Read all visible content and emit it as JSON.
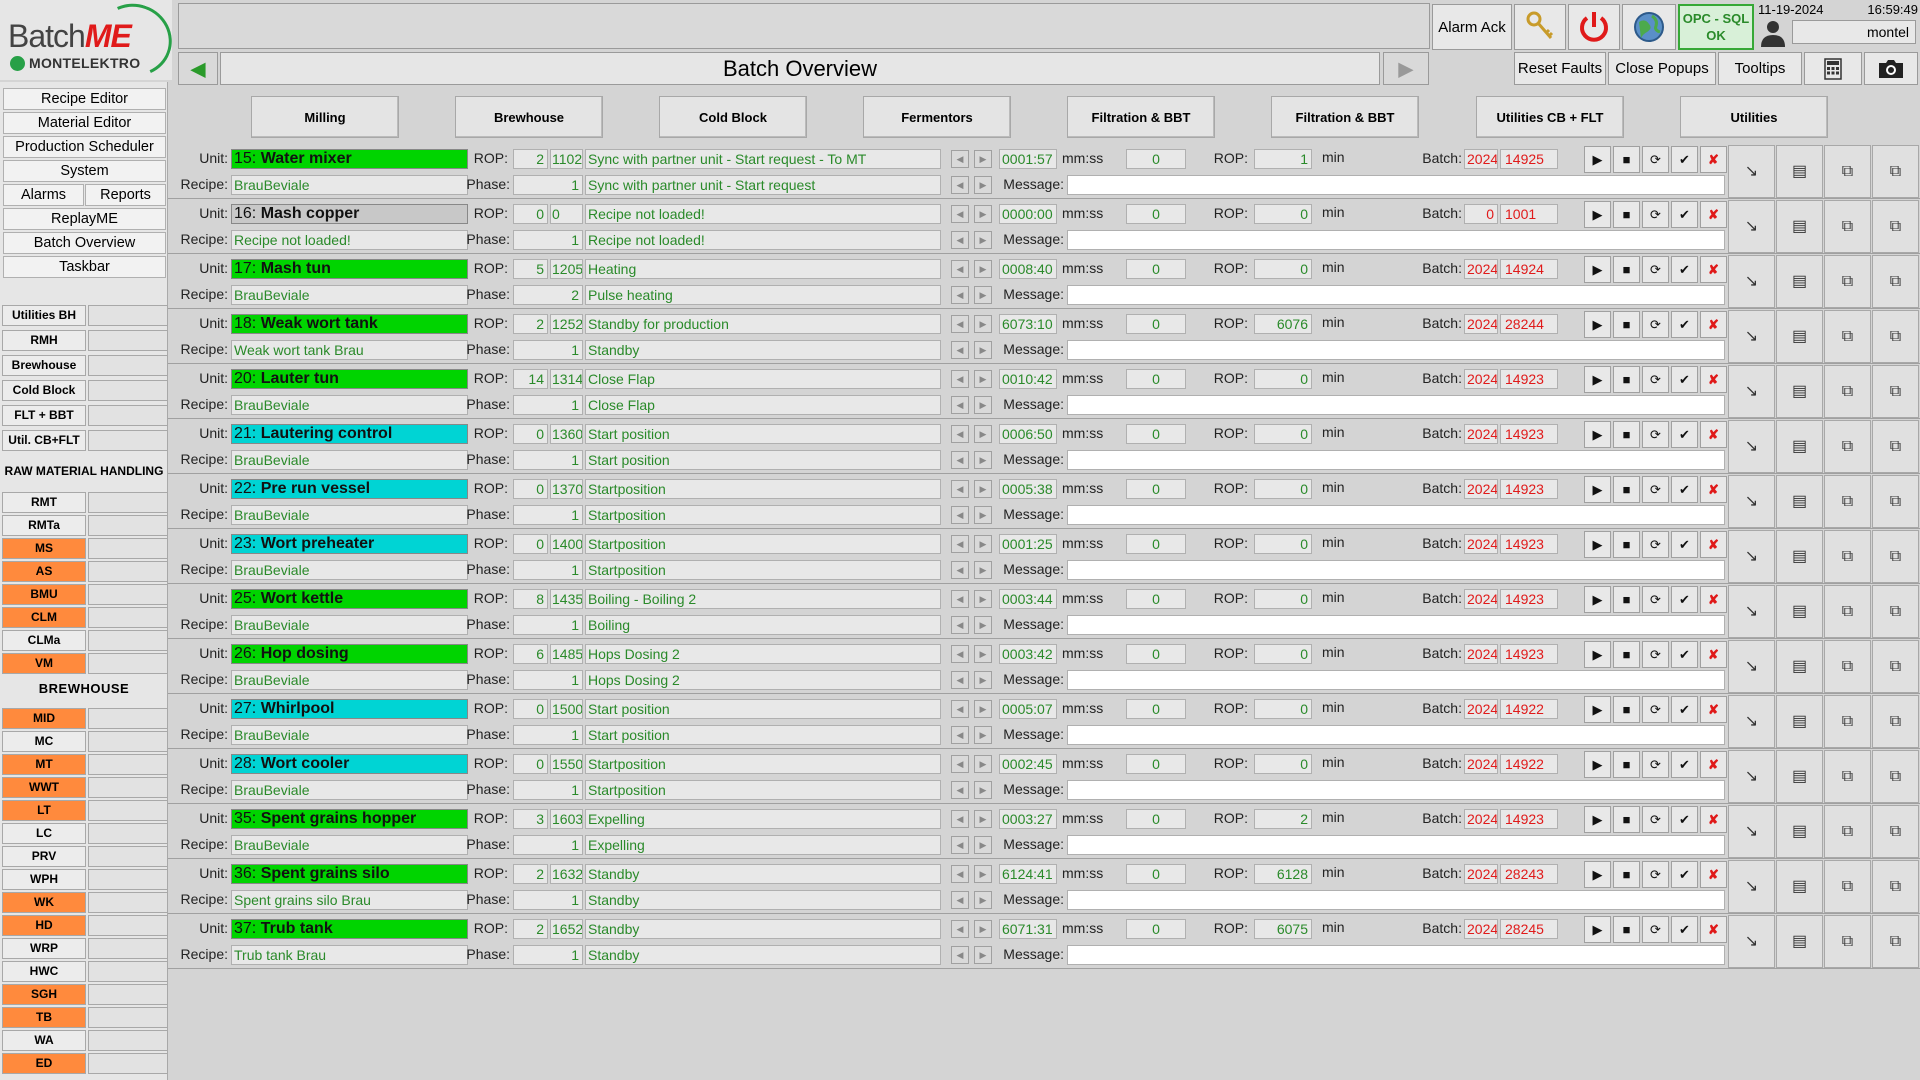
{
  "brand": {
    "name_part1": "Batch",
    "name_part2": "ME",
    "company": "MONTELEKTRO"
  },
  "header": {
    "page_title": "Batch Overview",
    "alarm_ack": "Alarm Ack",
    "reset_faults": "Reset Faults",
    "close_popups": "Close Popups",
    "tooltips": "Tooltips",
    "opc_status_line1": "OPC - SQL",
    "opc_status_line2": "OK",
    "date": "11-19-2024",
    "time": "16:59:49",
    "user": "montel",
    "icons": [
      "keys-icon",
      "power-icon",
      "globe-icon",
      "calculator-icon",
      "camera-icon"
    ]
  },
  "sidebar": {
    "menu": [
      "Recipe Editor",
      "Material Editor",
      "Production Scheduler",
      "System",
      "Alarms",
      "Reports",
      "ReplayME",
      "Batch Overview",
      "Taskbar"
    ],
    "area_buttons": [
      "Utilities BH",
      "RMH",
      "Brewhouse",
      "Cold Block",
      "FLT + BBT",
      "Util. CB+FLT"
    ],
    "raw_material_header": "RAW MATERIAL HANDLING",
    "raw_material_items": [
      {
        "label": "RMT",
        "orange": false
      },
      {
        "label": "RMTa",
        "orange": false
      },
      {
        "label": "MS",
        "orange": true
      },
      {
        "label": "AS",
        "orange": true
      },
      {
        "label": "BMU",
        "orange": true
      },
      {
        "label": "CLM",
        "orange": true
      },
      {
        "label": "CLMa",
        "orange": false
      },
      {
        "label": "VM",
        "orange": true
      }
    ],
    "brewhouse_header": "BREWHOUSE",
    "brewhouse_items": [
      {
        "label": "MID",
        "orange": true
      },
      {
        "label": "MC",
        "orange": false
      },
      {
        "label": "MT",
        "orange": true
      },
      {
        "label": "WWT",
        "orange": true
      },
      {
        "label": "LT",
        "orange": true
      },
      {
        "label": "LC",
        "orange": false
      },
      {
        "label": "PRV",
        "orange": false
      },
      {
        "label": "WPH",
        "orange": false
      },
      {
        "label": "WK",
        "orange": true
      },
      {
        "label": "HD",
        "orange": true
      },
      {
        "label": "WRP",
        "orange": false
      },
      {
        "label": "HWC",
        "orange": false
      },
      {
        "label": "SGH",
        "orange": true
      },
      {
        "label": "TB",
        "orange": true
      },
      {
        "label": "WA",
        "orange": false
      },
      {
        "label": "ED",
        "orange": true
      }
    ]
  },
  "tabs": [
    "Milling",
    "Brewhouse",
    "Cold Block",
    "Fermentors",
    "Filtration & BBT",
    "Filtration & BBT",
    "Utilities CB + FLT",
    "Utilities"
  ],
  "labels": {
    "unit": "Unit:",
    "recipe": "Recipe:",
    "rop": "ROP:",
    "phase": "Phase:",
    "mmss": "mm:ss",
    "min": "min",
    "batch": "Batch:",
    "message": "Message:"
  },
  "units": [
    {
      "nr": "15:",
      "name": "Water mixer",
      "color": "green",
      "recipe": "BrauBeviale",
      "rop": "2",
      "rop_code": "1102",
      "rop_text": "Sync with partner unit - Start request - To MT",
      "phase": "1",
      "phase_text": "Sync with partner unit - Start request",
      "timer": "0001:57",
      "val": "0",
      "rop2": "1",
      "batch_year": "2024",
      "batch_no": "14925"
    },
    {
      "nr": "16:",
      "name": "Mash copper",
      "color": "gray",
      "recipe": "Recipe not loaded!",
      "rop": "0",
      "rop_code": "0",
      "rop_text": "Recipe not loaded!",
      "phase": "1",
      "phase_text": "Recipe not loaded!",
      "timer": "0000:00",
      "val": "0",
      "rop2": "0",
      "batch_year": "0",
      "batch_no": "1001"
    },
    {
      "nr": "17:",
      "name": "Mash tun",
      "color": "green",
      "recipe": "BrauBeviale",
      "rop": "5",
      "rop_code": "1205",
      "rop_text": "Heating",
      "phase": "2",
      "phase_text": "Pulse heating",
      "timer": "0008:40",
      "val": "0",
      "rop2": "0",
      "batch_year": "2024",
      "batch_no": "14924"
    },
    {
      "nr": "18:",
      "name": "Weak wort tank",
      "color": "green",
      "recipe": "Weak wort tank Brau",
      "rop": "2",
      "rop_code": "1252",
      "rop_text": "Standby for production",
      "phase": "1",
      "phase_text": "Standby",
      "timer": "6073:10",
      "val": "0",
      "rop2": "6076",
      "batch_year": "2024",
      "batch_no": "28244"
    },
    {
      "nr": "20:",
      "name": "Lauter tun",
      "color": "green",
      "recipe": "BrauBeviale",
      "rop": "14",
      "rop_code": "1314",
      "rop_text": "Close Flap",
      "phase": "1",
      "phase_text": "Close Flap",
      "timer": "0010:42",
      "val": "0",
      "rop2": "0",
      "batch_year": "2024",
      "batch_no": "14923"
    },
    {
      "nr": "21:",
      "name": "Lautering control",
      "color": "cyan",
      "recipe": "BrauBeviale",
      "rop": "0",
      "rop_code": "1360",
      "rop_text": "Start position",
      "phase": "1",
      "phase_text": "Start position",
      "timer": "0006:50",
      "val": "0",
      "rop2": "0",
      "batch_year": "2024",
      "batch_no": "14923"
    },
    {
      "nr": "22:",
      "name": "Pre run vessel",
      "color": "cyan",
      "recipe": "BrauBeviale",
      "rop": "0",
      "rop_code": "1370",
      "rop_text": "Startposition",
      "phase": "1",
      "phase_text": "Startposition",
      "timer": "0005:38",
      "val": "0",
      "rop2": "0",
      "batch_year": "2024",
      "batch_no": "14923"
    },
    {
      "nr": "23:",
      "name": "Wort preheater",
      "color": "cyan",
      "recipe": "BrauBeviale",
      "rop": "0",
      "rop_code": "1400",
      "rop_text": "Startposition",
      "phase": "1",
      "phase_text": "Startposition",
      "timer": "0001:25",
      "val": "0",
      "rop2": "0",
      "batch_year": "2024",
      "batch_no": "14923"
    },
    {
      "nr": "25:",
      "name": "Wort kettle",
      "color": "green",
      "recipe": "BrauBeviale",
      "rop": "8",
      "rop_code": "1435",
      "rop_text": "Boiling - Boiling 2",
      "phase": "1",
      "phase_text": "Boiling",
      "timer": "0003:44",
      "val": "0",
      "rop2": "0",
      "batch_year": "2024",
      "batch_no": "14923"
    },
    {
      "nr": "26:",
      "name": "Hop dosing",
      "color": "green",
      "recipe": "BrauBeviale",
      "rop": "6",
      "rop_code": "1485",
      "rop_text": "Hops Dosing 2",
      "phase": "1",
      "phase_text": "Hops Dosing 2",
      "timer": "0003:42",
      "val": "0",
      "rop2": "0",
      "batch_year": "2024",
      "batch_no": "14923"
    },
    {
      "nr": "27:",
      "name": "Whirlpool",
      "color": "cyan",
      "recipe": "BrauBeviale",
      "rop": "0",
      "rop_code": "1500",
      "rop_text": "Start position",
      "phase": "1",
      "phase_text": "Start position",
      "timer": "0005:07",
      "val": "0",
      "rop2": "0",
      "batch_year": "2024",
      "batch_no": "14922"
    },
    {
      "nr": "28:",
      "name": "Wort cooler",
      "color": "cyan",
      "recipe": "BrauBeviale",
      "rop": "0",
      "rop_code": "1550",
      "rop_text": "Startposition",
      "phase": "1",
      "phase_text": "Startposition",
      "timer": "0002:45",
      "val": "0",
      "rop2": "0",
      "batch_year": "2024",
      "batch_no": "14922"
    },
    {
      "nr": "35:",
      "name": "Spent grains hopper",
      "color": "green",
      "recipe": "BrauBeviale",
      "rop": "3",
      "rop_code": "1603",
      "rop_text": "Expelling",
      "phase": "1",
      "phase_text": "Expelling",
      "timer": "0003:27",
      "val": "0",
      "rop2": "2",
      "batch_year": "2024",
      "batch_no": "14923"
    },
    {
      "nr": "36:",
      "name": "Spent grains silo",
      "color": "green",
      "recipe": "Spent grains silo Brau",
      "rop": "2",
      "rop_code": "1632",
      "rop_text": "Standby",
      "phase": "1",
      "phase_text": "Standby",
      "timer": "6124:41",
      "val": "0",
      "rop2": "6128",
      "batch_year": "2024",
      "batch_no": "28243"
    },
    {
      "nr": "37:",
      "name": "Trub tank",
      "color": "green",
      "recipe": "Trub tank Brau",
      "rop": "2",
      "rop_code": "1652",
      "rop_text": "Standby",
      "phase": "1",
      "phase_text": "Standby",
      "timer": "6071:31",
      "val": "0",
      "rop2": "6075",
      "batch_year": "2024",
      "batch_no": "28245"
    }
  ],
  "row_control_icons": [
    "play-icon",
    "stop-icon",
    "reset-icon",
    "check-icon",
    "reject-icon"
  ],
  "row_side_icons": [
    "trend-icon",
    "report-icon",
    "copy-icon",
    "copy-multi-icon"
  ]
}
